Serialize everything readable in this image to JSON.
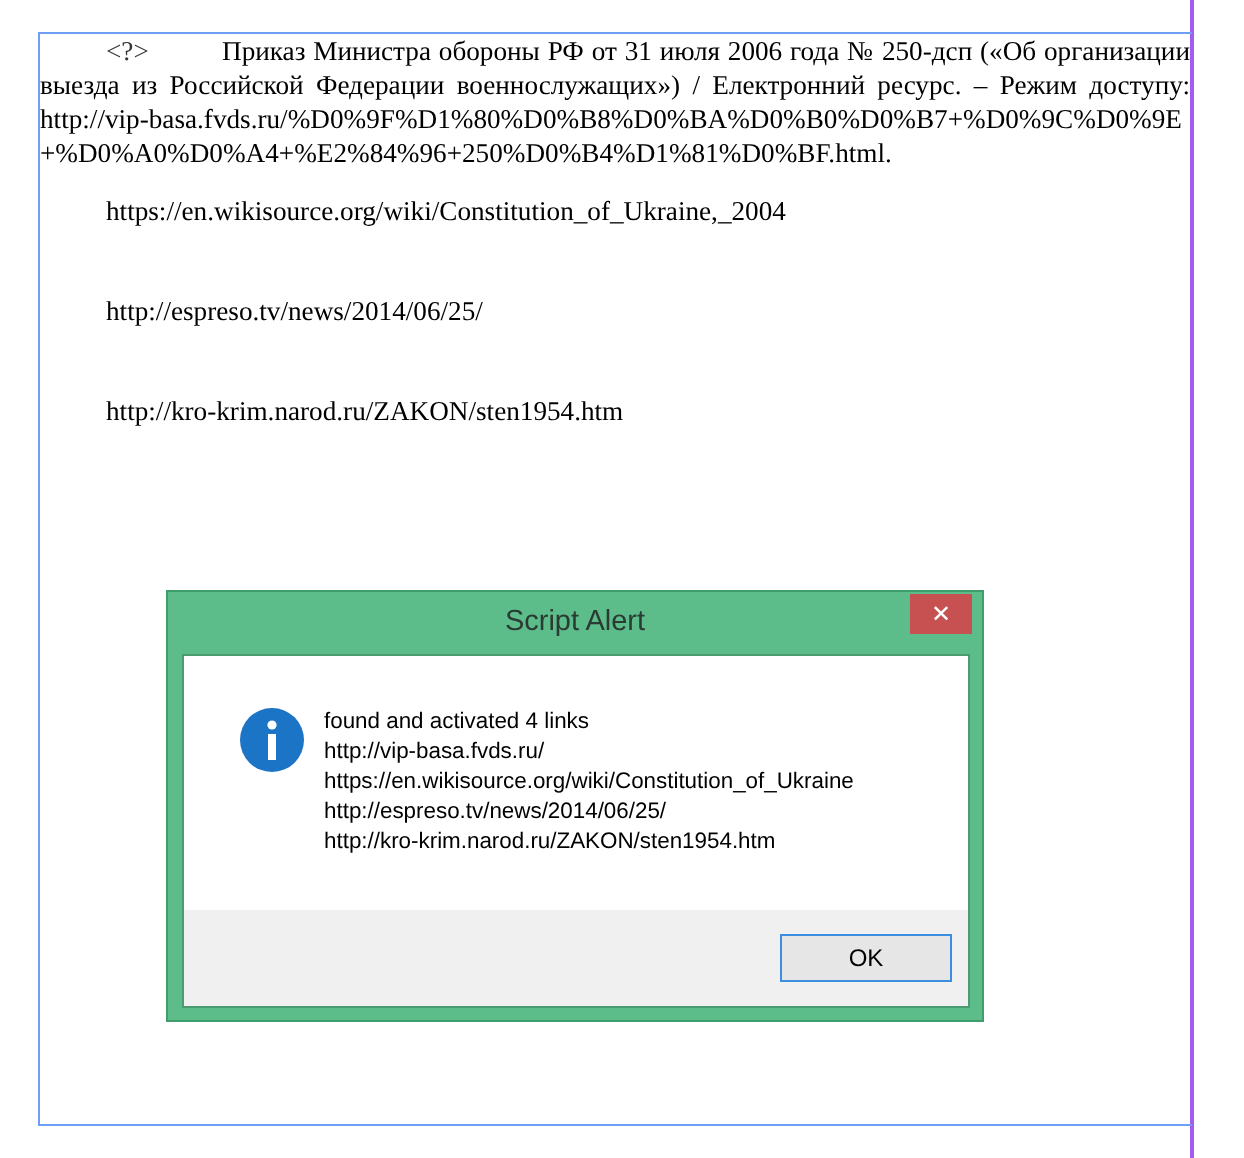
{
  "document": {
    "paragraphs": [
      {
        "kind": "reference",
        "marker": "<?>",
        "text": "Приказ Министра обороны РФ от 31 июля 2006 года № 250-дсп («Об организации выезда из Российской Федерации военнослужащих») / Електронний ресурс. – Режим доступу:",
        "url": "http://vip-basa.fvds.ru/%D0%9F%D1%80%D0%B8%D0%BA%D0%B0%D0%B7+%D0%9C%D0%9E+%D0%A0%D0%A4+%E2%84%96+250%D0%B4%D1%81%D0%BF.html."
      },
      {
        "kind": "url",
        "text": "https://en.wikisource.org/wiki/Constitution_of_Ukraine,_2004"
      },
      {
        "kind": "url",
        "text": "http://espreso.tv/news/2014/06/25/"
      },
      {
        "kind": "url",
        "text": "http://kro-krim.narod.ru/ZAKON/sten1954.htm"
      }
    ]
  },
  "dialog": {
    "title": "Script Alert",
    "close": "✕",
    "message_lines": [
      "found and activated 4 links",
      "http://vip-basa.fvds.ru/",
      "https://en.wikisource.org/wiki/Constitution_of_Ukraine",
      "http://espreso.tv/news/2014/06/25/",
      "http://kro-krim.narod.ru/ZAKON/sten1954.htm"
    ],
    "buttons": [
      "OK"
    ]
  }
}
